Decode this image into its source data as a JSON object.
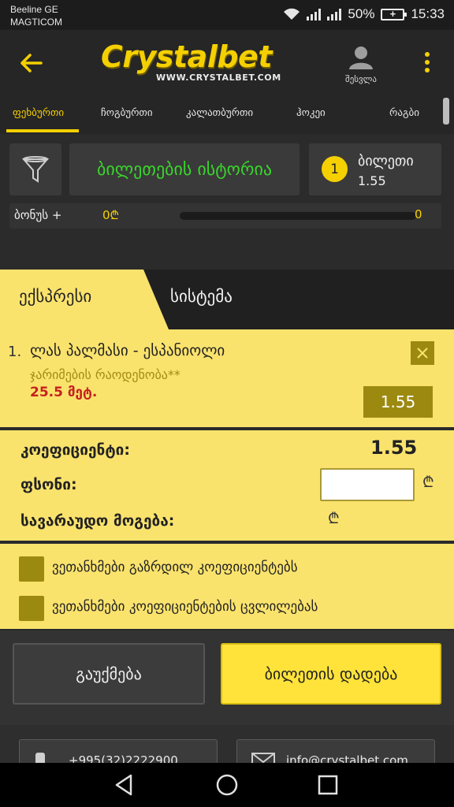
{
  "status_bar": {
    "carrier_line1": "Beeline GE",
    "carrier_line2": "MAGTICOM",
    "battery": "50%",
    "time": "15:33"
  },
  "header": {
    "logo_text": "Crystalbet",
    "logo_url": "WWW.CRYSTALBET.COM",
    "profile_label": "შესვლა",
    "accent_color": "#f5d000"
  },
  "sports_tabs": [
    {
      "label": "ფეხბურთი",
      "active": true
    },
    {
      "label": "ჩოგბურთი",
      "active": false
    },
    {
      "label": "კალათბურთი",
      "active": false
    },
    {
      "label": "ჰოკეი",
      "active": false
    },
    {
      "label": "რაგბი",
      "active": false
    }
  ],
  "controls": {
    "history_label": "ბილეთების ისტორია",
    "ticket_count": "1",
    "ticket_label": "ბილეთი",
    "ticket_odds": "1.55"
  },
  "bonus": {
    "label": "ბონუს +",
    "value": "0₾",
    "progress": 0,
    "end_value": "0"
  },
  "bet_tabs": {
    "express": "ექსპრესი",
    "system": "სისტემა"
  },
  "selection": {
    "number": "1.",
    "match": "ლას პალმასი - ესპანიოლი",
    "market": "ჯარიმების რაოდენობა**",
    "pick": "25.5 მეტ.",
    "odds": "1.55"
  },
  "summary": {
    "coef_label": "კოეფიციენტი:",
    "coef_value": "1.55",
    "stake_label": "ფსონი:",
    "stake_value": "",
    "stake_currency": "₾",
    "win_label": "სავარაუდო მოგება:",
    "win_currency": "₾"
  },
  "agreements": {
    "accept_increased": "ვეთანხმები გაზრდილ კოეფიციენტებს",
    "accept_changes": "ვეთანხმები კოეფიციენტების ცვლილებას"
  },
  "actions": {
    "cancel": "გაუქმება",
    "place": "ბილეთის დადება"
  },
  "contacts": {
    "phone": "+995(32)2222900",
    "email": "info@crystalbet.com"
  },
  "icons": {
    "back": "back-arrow-icon",
    "profile": "user-icon",
    "menu": "more-vert-icon",
    "filter": "funnel-icon",
    "close": "close-icon",
    "phone": "phone-icon",
    "email": "mail-icon",
    "nav_back": "nav-back-icon",
    "nav_home": "nav-home-icon",
    "nav_recents": "nav-recents-icon"
  }
}
